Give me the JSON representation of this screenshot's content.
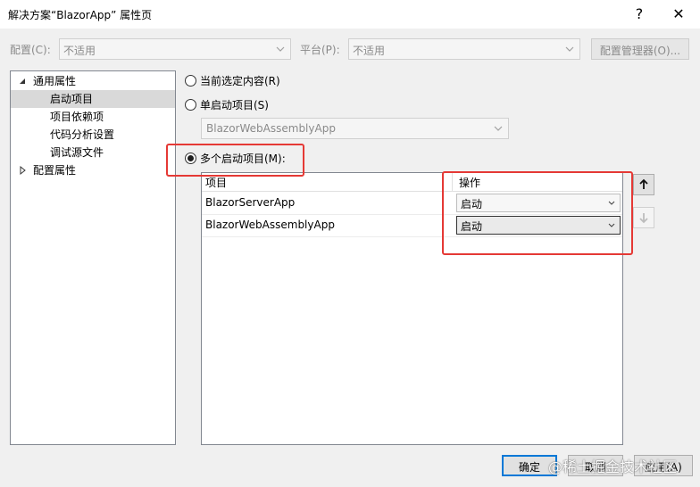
{
  "window": {
    "title": "解决方案“BlazorApp” 属性页",
    "help_glyph": "?",
    "close_glyph": "✕"
  },
  "toolbar": {
    "config_label": "配置(C):",
    "config_value": "不适用",
    "platform_label": "平台(P):",
    "platform_value": "不适用",
    "config_manager_label": "配置管理器(O)..."
  },
  "tree": {
    "items": [
      {
        "label": "通用属性",
        "expanded": true
      },
      {
        "label": "启动项目",
        "selected": true
      },
      {
        "label": "项目依赖项"
      },
      {
        "label": "代码分析设置"
      },
      {
        "label": "调试源文件"
      },
      {
        "label": "配置属性",
        "expanded": false
      }
    ]
  },
  "startup": {
    "current_selection_label": "当前选定内容(R)",
    "single_label": "单启动项目(S)",
    "single_value": "BlazorWebAssemblyApp",
    "multiple_label": "多个启动项目(M):",
    "selected_option": "multiple"
  },
  "grid": {
    "col_project": "项目",
    "col_action": "操作",
    "rows": [
      {
        "project": "BlazorServerApp",
        "action": "启动"
      },
      {
        "project": "BlazorWebAssemblyApp",
        "action": "启动"
      }
    ]
  },
  "footer": {
    "ok_label": "确定",
    "cancel_label": "取消",
    "apply_label": "应用(A)"
  },
  "watermark": "@稀土掘金技术社区",
  "colors": {
    "highlight": "#e53935",
    "focus_border": "#0078d7"
  }
}
